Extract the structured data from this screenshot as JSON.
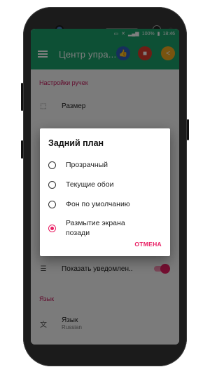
{
  "status_bar": {
    "battery": "100%",
    "time": "18:46",
    "icons": [
      "cast-icon",
      "mute-icon",
      "signal-icon",
      "battery-icon"
    ]
  },
  "app_bar": {
    "title": "Центр упра...",
    "actions": [
      "thumbs-up-icon",
      "stop-icon",
      "share-icon"
    ]
  },
  "settings": {
    "section_handles": "Настройки ручек",
    "size_label": "Размер",
    "notify_label": "Показать уведомлен..",
    "notify_toggle_on": true,
    "section_language": "Язык",
    "language_label": "Язык",
    "language_value": "Russian"
  },
  "dialog": {
    "title": "Задний план",
    "options": [
      {
        "label": "Прозрачный",
        "selected": false
      },
      {
        "label": "Текущие обои",
        "selected": false
      },
      {
        "label": "Фон по умолчанию",
        "selected": false
      },
      {
        "label": "Размытие экрана позади",
        "selected": true
      }
    ],
    "cancel_label": "ОТМЕНА"
  },
  "colors": {
    "primary": "#1aa06b",
    "accent": "#e91e63",
    "section_header": "#c2185b"
  }
}
